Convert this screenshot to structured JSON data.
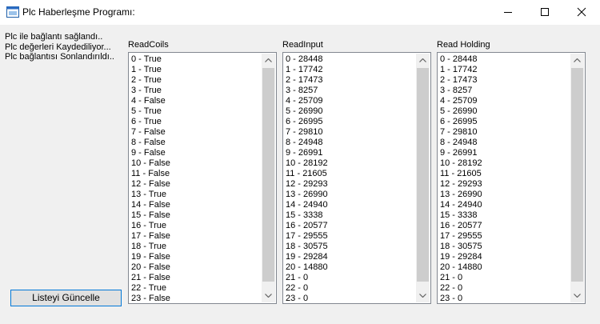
{
  "window": {
    "title": "Plc Haberleşme Programı:",
    "icon": "app-window-icon",
    "controls": [
      "minimize-icon",
      "maximize-icon",
      "close-icon"
    ]
  },
  "status_lines": [
    "Plc ile bağlantı sağlandı..",
    "Plc değerleri Kaydediliyor...",
    "Plc bağlantısı Sonlandırıldı.."
  ],
  "update_button_label": "Listeyi Güncelle",
  "lists": {
    "coils": {
      "label": "ReadCoils",
      "items": [
        "0 - True",
        "1 - True",
        "2 - True",
        "3 - True",
        "4 - False",
        "5 - True",
        "6 - True",
        "7 - False",
        "8 - False",
        "9 - False",
        "10 - False",
        "11 - False",
        "12 - False",
        "13 - True",
        "14 - False",
        "15 - False",
        "16 - True",
        "17 - False",
        "18 - True",
        "19 - False",
        "20 - False",
        "21 - False",
        "22 - True",
        "23 - False"
      ]
    },
    "input": {
      "label": "ReadInput",
      "items": [
        "0 - 28448",
        "1 - 17742",
        "2 - 17473",
        "3 - 8257",
        "4 - 25709",
        "5 - 26990",
        "6 - 26995",
        "7 - 29810",
        "8 - 24948",
        "9 - 26991",
        "10 - 28192",
        "11 - 21605",
        "12 - 29293",
        "13 - 26990",
        "14 - 24940",
        "15 - 3338",
        "16 - 20577",
        "17 - 29555",
        "18 - 30575",
        "19 - 29284",
        "20 - 14880",
        "21 - 0",
        "22 - 0",
        "23 - 0"
      ]
    },
    "holding": {
      "label": "Read Holding",
      "items": [
        "0 - 28448",
        "1 - 17742",
        "2 - 17473",
        "3 - 8257",
        "4 - 25709",
        "5 - 26990",
        "6 - 26995",
        "7 - 29810",
        "8 - 24948",
        "9 - 26991",
        "10 - 28192",
        "11 - 21605",
        "12 - 29293",
        "13 - 26990",
        "14 - 24940",
        "15 - 3338",
        "16 - 20577",
        "17 - 29555",
        "18 - 30575",
        "19 - 29284",
        "20 - 14880",
        "21 - 0",
        "22 - 0",
        "23 - 0"
      ]
    }
  }
}
